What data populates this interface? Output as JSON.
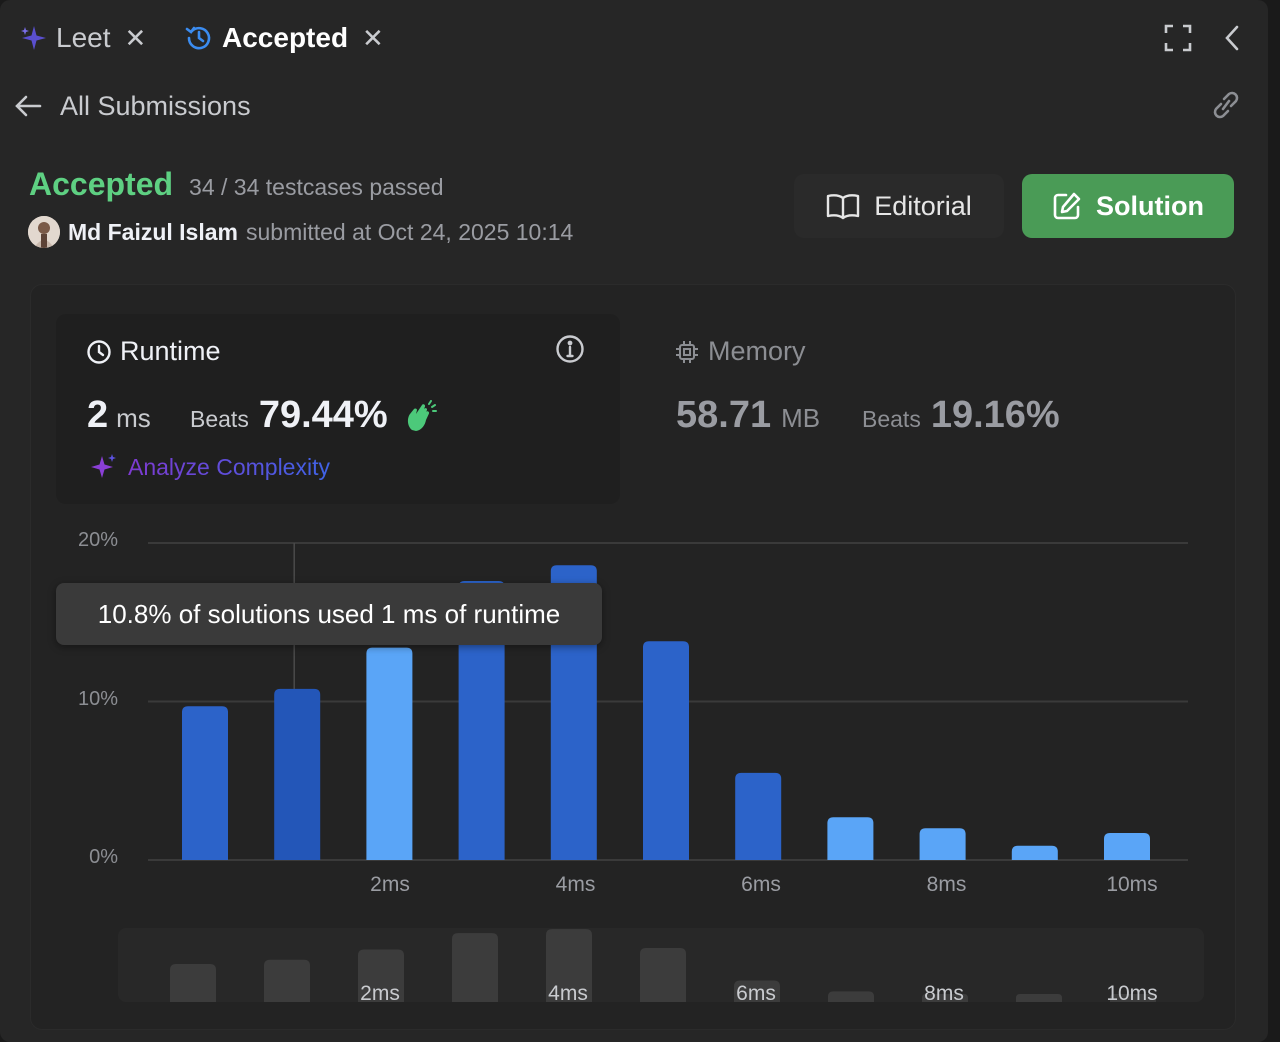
{
  "tabs": [
    {
      "label": "Leet",
      "icon": "sparkle-icon",
      "active": false
    },
    {
      "label": "Accepted",
      "icon": "history-icon",
      "active": true
    }
  ],
  "header": {
    "back_label": "All Submissions"
  },
  "submission": {
    "status": "Accepted",
    "testcases": "34 / 34 testcases passed",
    "user": "Md Faizul Islam",
    "submitted": "submitted at Oct 24, 2025 10:14"
  },
  "buttons": {
    "editorial": "Editorial",
    "solution": "Solution"
  },
  "runtime": {
    "title": "Runtime",
    "value": "2",
    "unit": "ms",
    "beats_label": "Beats",
    "beats_value": "79.44%",
    "analyze": "Analyze Complexity"
  },
  "memory": {
    "title": "Memory",
    "value": "58.71",
    "unit": "MB",
    "beats_label": "Beats",
    "beats_value": "19.16%"
  },
  "tooltip": "10.8% of solutions used 1 ms of runtime",
  "colors": {
    "accepted": "#5ed082",
    "solution_button": "#4a9b56",
    "bar": "#2c63c9",
    "bar_light": "#5aa5f7",
    "bar_highlight": "#2356b8"
  },
  "chart_data": {
    "type": "bar",
    "y_tick_labels": [
      "0%",
      "10%",
      "20%"
    ],
    "x_tick_labels": [
      "2ms",
      "4ms",
      "6ms",
      "8ms",
      "10ms"
    ],
    "ylim": [
      0,
      20
    ],
    "grid": true,
    "series": [
      {
        "values": [
          9.7,
          10.8,
          13.4,
          17.6,
          18.6,
          13.8,
          5.5,
          2.7,
          2.0,
          0.9,
          1.7
        ]
      }
    ],
    "overview_tick_labels": [
      "2ms",
      "4ms",
      "6ms",
      "8ms",
      "10ms"
    ]
  }
}
